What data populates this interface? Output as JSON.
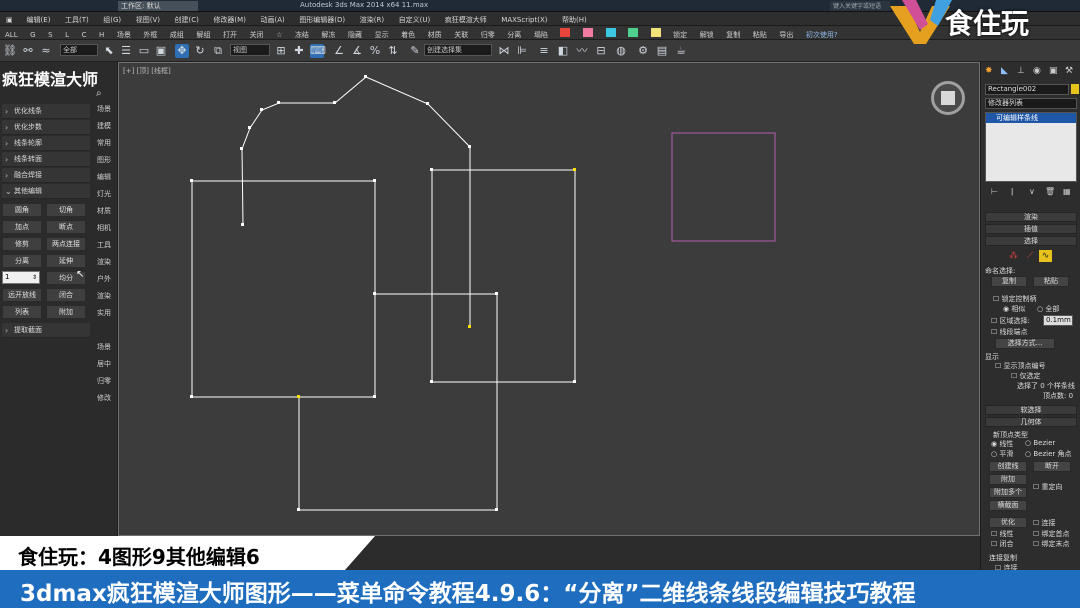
{
  "titlebar": {
    "workspace": "工作区: 默认",
    "app_title": "Autodesk 3ds Max 2014 x64  11.max",
    "search": "键入关键字或短语"
  },
  "menubar": {
    "items": [
      "编辑(E)",
      "工具(T)",
      "组(G)",
      "视图(V)",
      "创建(C)",
      "修改器(M)",
      "动画(A)",
      "图形编辑器(D)",
      "渲染(R)",
      "自定义(U)",
      "疯狂模渲大师",
      "MAXScript(X)",
      "帮助(H)"
    ]
  },
  "toolbar2": {
    "items": [
      "ALL",
      "G",
      "S",
      "L",
      "C",
      "H",
      "场景",
      "外框",
      "成组",
      "解组",
      "打开",
      "关闭",
      "☆",
      "冻结",
      "解冻",
      "隐藏",
      "显示",
      "着色",
      "材质",
      "关联",
      "归零",
      "分离",
      "塌陷"
    ],
    "right_items": [
      "锁定",
      "解锁",
      "复制",
      "粘贴",
      "导出"
    ],
    "help": "初次使用?"
  },
  "toolbar3": {
    "filter_dropdown": "全部",
    "view_dropdown": "视图",
    "selection_set": "创建选择集"
  },
  "left_panel": {
    "title": "疯狂模渲大师",
    "rows": [
      {
        "label": "优化线条"
      },
      {
        "label": "优化步数"
      },
      {
        "label": "线条轮廓"
      },
      {
        "label": "线条转面"
      },
      {
        "label": "融合焊接"
      },
      {
        "label": "其他编辑"
      }
    ],
    "buttons": [
      "圆角",
      "切角",
      "加点",
      "断点",
      "修剪",
      "两点连接",
      "分离",
      "延伸",
      "",
      "均分",
      "远开放线",
      "闭合",
      "列表",
      "附加"
    ],
    "spinner_value": "1",
    "extract": "提取截面",
    "right_tabs": [
      "场景",
      "建模",
      "常用",
      "图形",
      "编辑",
      "灯光",
      "材质",
      "相机",
      "工具",
      "渲染",
      "户外",
      "渲染",
      "实用",
      "场景",
      "居中",
      "归零",
      "修改"
    ]
  },
  "viewport": {
    "label": "[+] [顶] [线框]"
  },
  "right_panel": {
    "object_name": "Rectangle002",
    "modifier_list": "修改器列表",
    "stack_item": "可编辑样条线",
    "rollouts": [
      "渲染",
      "插值",
      "选择"
    ],
    "named_selection": "命名选择:",
    "copy": "复制",
    "paste": "粘贴",
    "lock_handles": "锁定控制柄",
    "alike": "相似",
    "all": "全部",
    "area_select": "区域选择:",
    "area_value": "0.1mm",
    "segment_end": "线段端点",
    "select_by": "选择方式...",
    "display": "显示",
    "show_vertex_numbers": "显示顶点编号",
    "selected_only": "仅选定",
    "selection_info": "选择了 0 个样条线",
    "vertex_info": "顶点数: 0",
    "soft_selection": "软选择",
    "geometry": "几何体",
    "new_vertex_type": "新顶点类型",
    "linear": "线性",
    "bezier": "Bezier",
    "smooth": "平滑",
    "bezier_corner": "Bezier 角点",
    "create_line": "创建线",
    "break": "断开",
    "attach": "附加",
    "reorient": "重定向",
    "attach_multiple": "附加多个",
    "cross_section": "横截面",
    "refine": "优化",
    "connect": "连接",
    "linear2": "线性",
    "bind_first": "绑定首点",
    "closed": "闭合",
    "bind_last": "绑定末点",
    "connect_copy": "连接复制",
    "connect2": "连接"
  },
  "captions": {
    "line1": "食住玩：4图形9其他编辑6",
    "line2": "3dmax疯狂模渲大师图形——菜单命令教程4.9.6：“分离”二维线条线段编辑技巧教程"
  },
  "watermark": {
    "text": "食住玩"
  },
  "colors": {
    "accent_blue": "#1e6dbf",
    "shape_white": "#ffffff",
    "selected_rect": "#b45ab4",
    "vertex_yellow": "#ffe000"
  }
}
